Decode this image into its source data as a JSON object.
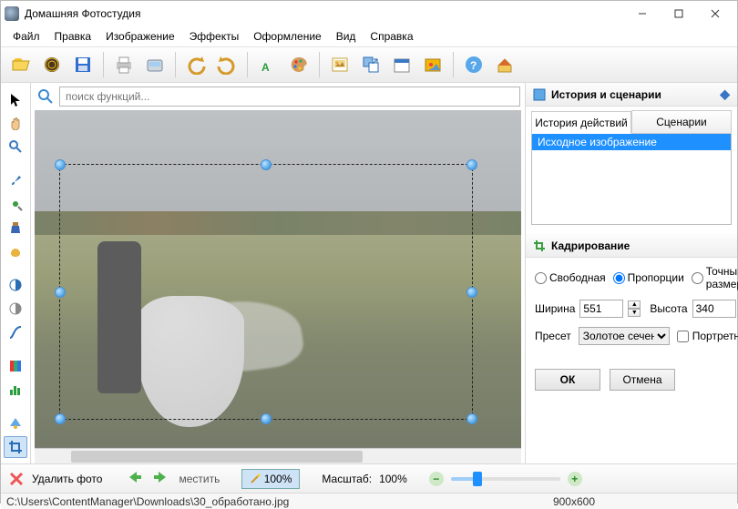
{
  "titlebar": {
    "title": "Домашняя Фотостудия"
  },
  "menu": [
    "Файл",
    "Правка",
    "Изображение",
    "Эффекты",
    "Оформление",
    "Вид",
    "Справка"
  ],
  "toolbar": {
    "open": "open-icon",
    "batch": "batch-icon",
    "save": "save-icon",
    "print": "print-icon",
    "scan": "scan-icon",
    "undo": "undo-icon",
    "redo": "redo-icon",
    "text": "text-icon",
    "effects": "palette-icon",
    "image": "image-icon",
    "resize": "resize-icon",
    "calendar": "calendar-icon",
    "collage": "collage-icon",
    "help": "help-icon",
    "home": "home-icon"
  },
  "sidetools": [
    "pointer-icon",
    "hand-icon",
    "zoom-icon",
    "spacer",
    "brush-icon",
    "retouch-icon",
    "clone-icon",
    "sponge-icon",
    "spacer",
    "contrast-icon",
    "saturation-icon",
    "curve-icon",
    "spacer",
    "rgb-icon",
    "levels-icon",
    "spacer",
    "auto-icon",
    "crop-icon"
  ],
  "search": {
    "placeholder": "поиск функций..."
  },
  "history": {
    "panel_title": "История и сценарии",
    "tabs": {
      "history": "История действий",
      "scenarios": "Сценарии"
    },
    "items": [
      "Исходное изображение"
    ]
  },
  "crop": {
    "panel_title": "Кадрирование",
    "radio_free": "Свободная",
    "radio_ratio": "Пропорции",
    "radio_exact": "Точный размер",
    "width_label": "Ширина",
    "width_value": "551",
    "height_label": "Высота",
    "height_value": "340",
    "preset_label": "Пресет",
    "preset_value": "Золотое сечение",
    "portrait_label": "Портретные",
    "ok": "ОК",
    "cancel": "Отмена"
  },
  "bottombar": {
    "delete_label": "Удалить фото",
    "fit_label": "местить",
    "zoom100": "100%",
    "scale_label": "Масштаб:",
    "scale_value": "100%"
  },
  "status": {
    "path": "C:\\Users\\ContentManager\\Downloads\\30_обработано.jpg",
    "dims": "900x600"
  }
}
